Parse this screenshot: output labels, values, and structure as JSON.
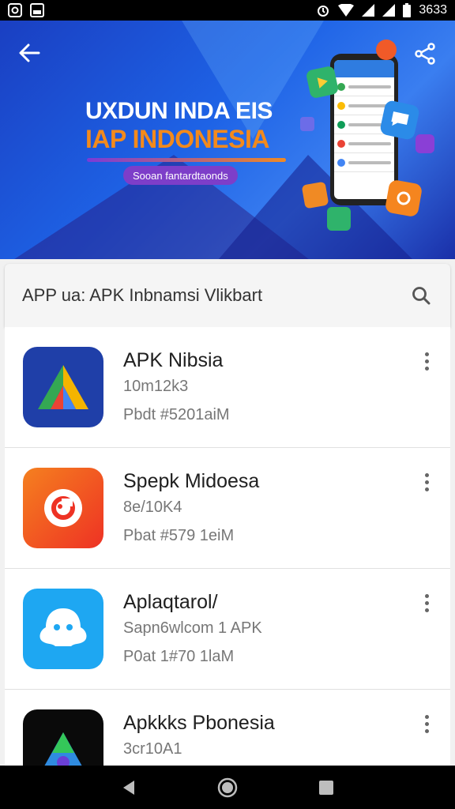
{
  "status_bar": {
    "time": "3633",
    "left_icons": [
      "notification-icon",
      "gallery-icon"
    ],
    "right_icons": [
      "alarm-icon",
      "wifi-icon",
      "signal-icon",
      "signal-icon",
      "battery-icon"
    ]
  },
  "banner": {
    "title_line1": "UXDUN INDA EIS",
    "title_line2": "IAP INDONESIA",
    "pill_text": "Sooan fantardtaonds",
    "back_icon": "back-arrow-icon",
    "share_icon": "share-icon",
    "colors": {
      "background": "#1e63e6",
      "accent": "#f38a1c",
      "pill": "#7d3ec9"
    }
  },
  "search": {
    "value": "APP ua: APK Inbnamsi Vlikbart",
    "icon": "search-icon"
  },
  "apps": [
    {
      "name": "APK Nibsia",
      "sub": "10m12k3",
      "meta": "Pbdt #5201aiM",
      "icon": "triangle-logo-icon",
      "icon_bg": "#1f3fa8"
    },
    {
      "name": "Spepk Midoesa",
      "sub": "8e/10K4",
      "meta": "Pbat #579 1eiM",
      "icon": "ring-logo-icon",
      "icon_bg": "#f24d24"
    },
    {
      "name": "Aplaqtarol/",
      "sub": "Sapn6wlcom 1 APK",
      "meta": "P0at 1#70 1laM",
      "icon": "ghost-logo-icon",
      "icon_bg": "#1ea7f2"
    },
    {
      "name": "Apkkks Pbonesia",
      "sub": "3cr10A1",
      "meta": "",
      "icon": "triangle-logo-icon",
      "icon_bg": "#0a0a0a"
    }
  ],
  "nav": {
    "back_icon": "nav-back-icon",
    "home_icon": "nav-home-icon",
    "recents_icon": "nav-recents-icon"
  }
}
